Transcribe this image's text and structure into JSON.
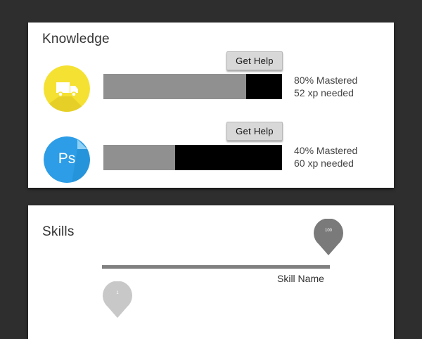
{
  "knowledge": {
    "title": "Knowledge",
    "courses": [
      {
        "icon": "truck-icon",
        "icon_color": "#f5e131",
        "help_label": "Get Help",
        "progress": 0.8,
        "mastered_text": "80% Mastered",
        "xp_text": "52 xp needed"
      },
      {
        "icon": "photoshop-icon",
        "icon_color": "#2c9de6",
        "icon_text": "Ps",
        "help_label": "Get Help",
        "progress": 0.4,
        "mastered_text": "40% Mastered",
        "xp_text": "60 xp needed"
      }
    ]
  },
  "skills": {
    "title": "Skills",
    "slider_name": "Skill Name",
    "max_label": "100",
    "min_label": "1"
  },
  "colors": {
    "background": "#2e2e2e",
    "progress_track": "#000000",
    "progress_fill": "#909090",
    "max_pin": "#7a7a7a",
    "min_pin": "#c8c8c8"
  }
}
